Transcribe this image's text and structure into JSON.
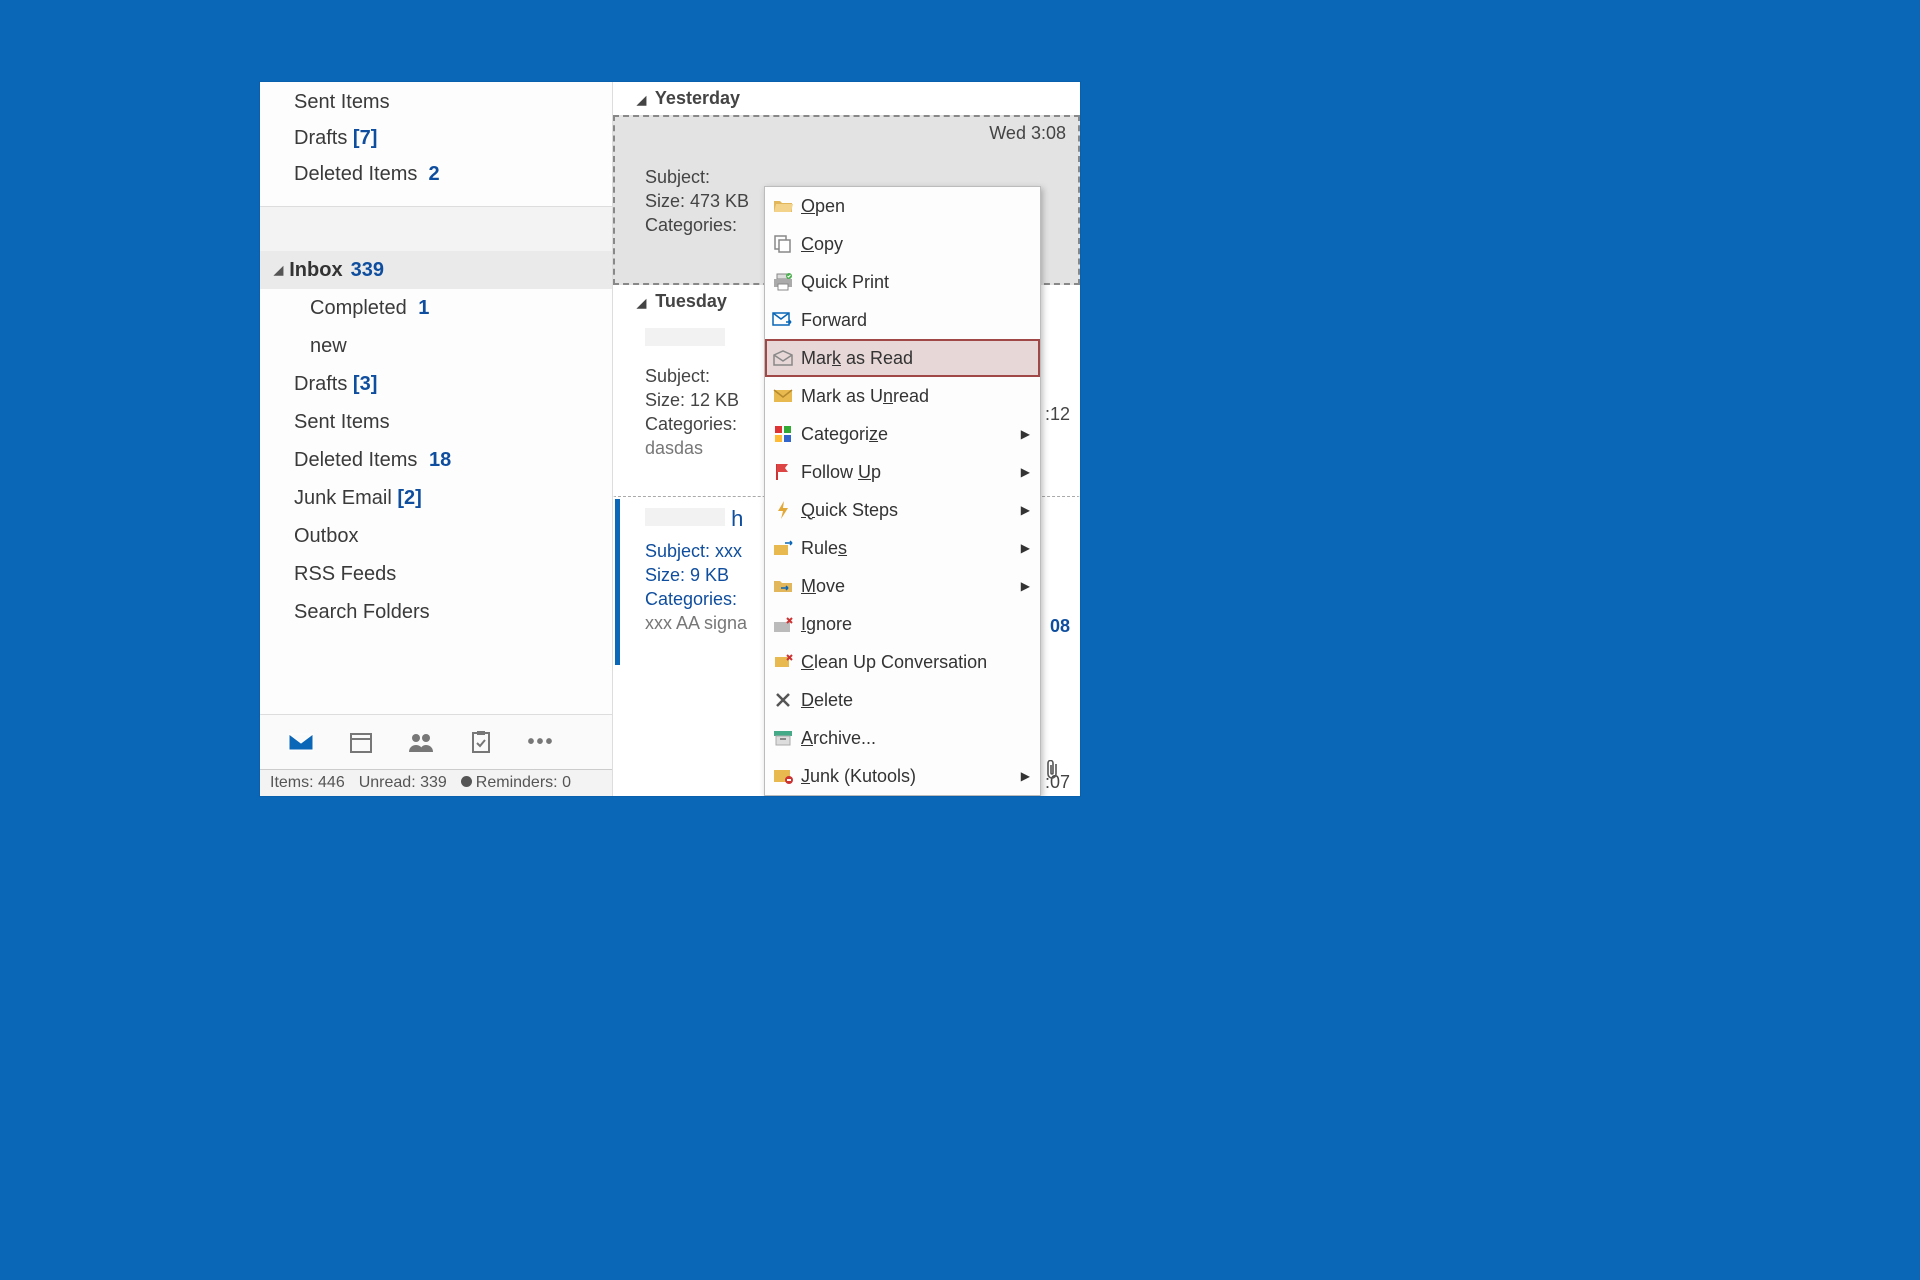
{
  "folders_top": {
    "sent": "Sent Items",
    "drafts_label": "Drafts",
    "drafts_count": "[7]",
    "deleted_label": "Deleted Items",
    "deleted_count": "2"
  },
  "inbox": {
    "label": "Inbox",
    "count": "339",
    "sub_completed": "Completed",
    "sub_completed_count": "1",
    "sub_new": "new"
  },
  "folders_main": {
    "drafts_label": "Drafts",
    "drafts_count": "[3]",
    "sent": "Sent Items",
    "deleted_label": "Deleted Items",
    "deleted_count": "18",
    "junk_label": "Junk Email",
    "junk_count": "[2]",
    "outbox": "Outbox",
    "rss": "RSS Feeds",
    "search": "Search Folders"
  },
  "status": {
    "items_label": "Items:",
    "items_value": "446",
    "unread_label": "Unread:",
    "unread_value": "339",
    "reminders_label": "Reminders:",
    "reminders_value": "0"
  },
  "groups": {
    "yesterday": "Yesterday",
    "tuesday": "Tuesday"
  },
  "msg1": {
    "time": "Wed 3:08",
    "subject_label": "Subject:",
    "size_label": "Size: 473 KB",
    "categories_label": "Categories:"
  },
  "msg2": {
    "time": ":12",
    "subject_label": "Subject:",
    "size_label": "Size: 12 KB",
    "categories_label": "Categories:",
    "body": "dasdas"
  },
  "msg3": {
    "time": "08",
    "from": "h",
    "subject_label": "Subject: xxx",
    "size_label": "Size: 9 KB",
    "categories_label": "Categories:",
    "body": "xxx  AA signa"
  },
  "msg4_time": ":07",
  "ctx": {
    "open": "Open",
    "copy": "Copy",
    "quick_print": "Quick Print",
    "forward": "Forward",
    "mark_read": "Mark as Read",
    "mark_unread": "Mark as Unread",
    "categorize": "Categorize",
    "follow_up": "Follow Up",
    "quick_steps": "Quick Steps",
    "rules": "Rules",
    "move": "Move",
    "ignore": "Ignore",
    "cleanup": "Clean Up Conversation",
    "delete": "Delete",
    "archive": "Archive...",
    "junk": "Junk (Kutools)"
  }
}
